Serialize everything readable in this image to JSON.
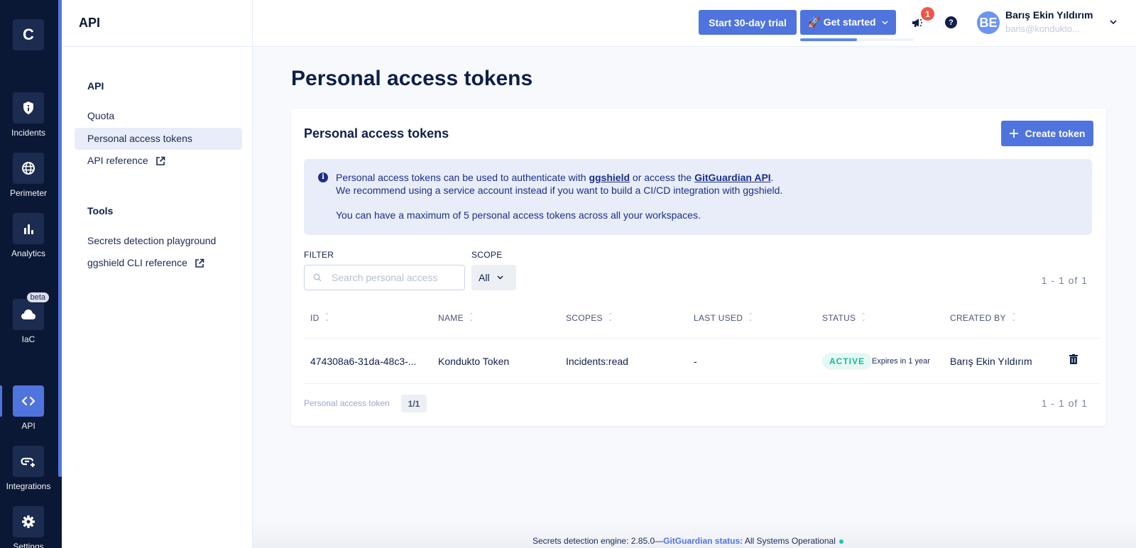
{
  "rail": {
    "logo": "C",
    "items": [
      {
        "label": "Incidents",
        "icon": "shield-info-icon"
      },
      {
        "label": "Perimeter",
        "icon": "globe-icon"
      },
      {
        "label": "Analytics",
        "icon": "bar-chart-icon"
      },
      {
        "label": "IaC",
        "icon": "cloud-icon",
        "badge": "beta"
      },
      {
        "label": "API",
        "icon": "code-icon",
        "active": true
      },
      {
        "label": "Integrations",
        "icon": "link-plus-icon"
      },
      {
        "label": "Settings",
        "icon": "gear-icon"
      }
    ]
  },
  "subnav": {
    "title": "API",
    "sections": [
      {
        "title": "API",
        "items": [
          {
            "label": "Quota"
          },
          {
            "label": "Personal access tokens",
            "active": true
          },
          {
            "label": "API reference",
            "external": true
          }
        ]
      },
      {
        "title": "Tools",
        "items": [
          {
            "label": "Secrets detection playground"
          },
          {
            "label": "ggshield CLI reference",
            "external": true
          }
        ]
      }
    ]
  },
  "header": {
    "trial_label": "Start 30-day trial",
    "get_started_label": "🚀 Get started",
    "get_started_progress": 0.5,
    "notifications_count": "1",
    "user": {
      "initials": "BE",
      "name": "Barış Ekin Yıldırım",
      "email": "baris@kondukto..."
    },
    "accent": "#4f74dd"
  },
  "main": {
    "page_title": "Personal access tokens",
    "card_title": "Personal access tokens",
    "create_label": "Create token",
    "info": {
      "line1_prefix": "Personal access tokens can be used to authenticate with ",
      "link1": "ggshield",
      "line1_mid": " or access the ",
      "link2": "GitGuardian API",
      "line1_suffix": ".",
      "line2": "We recommend using a service account instead if you want to build a CI/CD integration with ggshield.",
      "line3": "You can have a maximum of 5 personal access tokens across all your workspaces."
    },
    "filter_label": "FILTER",
    "search_placeholder": "Search personal access",
    "scope_label": "SCOPE",
    "scope_value": "All",
    "pagination_top": "1 - 1  of  1",
    "columns": [
      "ID",
      "NAME",
      "SCOPES",
      "LAST USED",
      "STATUS",
      "CREATED BY"
    ],
    "rows": [
      {
        "id": "474308a6-31da-48c3-...",
        "name": "Kondukto Token",
        "scopes": "Incidents:read",
        "last_used": "-",
        "status": "ACTIVE",
        "expires": "Expires in 1 year",
        "created_by": "Barış Ekin Yıldırım"
      }
    ],
    "footer_label": "Personal access token",
    "footer_page": "1/1",
    "pagination_bottom": "1 - 1  of  1"
  },
  "statusbar": {
    "engine": "Secrets detection engine: 2.85.0—",
    "status_link": "GitGuardian status:",
    "status_text": " All Systems Operational",
    "status_color": "#17c9a4"
  }
}
